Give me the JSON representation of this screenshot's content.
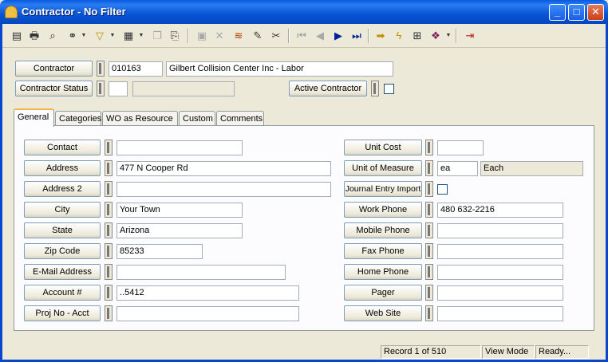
{
  "window": {
    "title": "Contractor - No Filter",
    "buttons": {
      "minimize": "_",
      "maximize": "□",
      "close": "✕"
    }
  },
  "header": {
    "contractor_label": "Contractor",
    "contractor_id": "010163",
    "contractor_name": "Gilbert Collision Center Inc - Labor",
    "status_label": "Contractor Status",
    "status_code": "",
    "status_desc": "",
    "active_label": "Active Contractor"
  },
  "tabs": [
    "General",
    "Categories",
    "WO as Resource",
    "Custom",
    "Comments"
  ],
  "left_fields": [
    {
      "label": "Contact",
      "value": ""
    },
    {
      "label": "Address",
      "value": "477 N Cooper Rd"
    },
    {
      "label": "Address 2",
      "value": ""
    },
    {
      "label": "City",
      "value": "Your Town"
    },
    {
      "label": "State",
      "value": "Arizona"
    },
    {
      "label": "Zip Code",
      "value": "85233"
    },
    {
      "label": "E-Mail Address",
      "value": ""
    },
    {
      "label": "Account #",
      "value": "..5412"
    },
    {
      "label": "Proj No - Acct",
      "value": ""
    }
  ],
  "right_fields": [
    {
      "label": "Unit Cost",
      "value": ""
    },
    {
      "label": "Unit of Measure",
      "value": "ea",
      "desc": "Each"
    },
    {
      "label": "Journal Entry Import",
      "value": ""
    },
    {
      "label": "Work Phone",
      "value": "480 632-2216"
    },
    {
      "label": "Mobile Phone",
      "value": ""
    },
    {
      "label": "Fax Phone",
      "value": ""
    },
    {
      "label": "Home Phone",
      "value": ""
    },
    {
      "label": "Pager",
      "value": ""
    },
    {
      "label": "Web Site",
      "value": ""
    }
  ],
  "toolbar": {
    "icons": [
      "grid-icon",
      "print-icon",
      "preview-icon",
      "binoculars-icon",
      "filter-icon",
      "form-icon",
      "copy-icon",
      "paste-icon",
      "save-icon",
      "delete-icon",
      "stack-icon",
      "pencil-icon",
      "scissors-icon",
      "first-icon",
      "prev-icon",
      "next-icon",
      "last-icon",
      "arrow-right-icon",
      "lightning-icon",
      "window-icon",
      "book-icon",
      "exit-icon"
    ],
    "glyphs": {
      "grid": "▤",
      "print": "🖶",
      "preview": "⌕",
      "binoculars": "⚭",
      "filter": "▽",
      "form": "▦",
      "copy": "❐",
      "paste": "⎘",
      "save": "▣",
      "delete": "✕",
      "stack": "≋",
      "pencil": "✎",
      "scissors": "✂",
      "first": "⏮",
      "prev": "◀",
      "next": "▶",
      "last": "⏭",
      "arrow": "➡",
      "lightning": "ϟ",
      "window": "⊞",
      "book": "❖",
      "exit": "⇥"
    },
    "dropdown": "▼"
  },
  "status": {
    "record": "Record 1 of 510",
    "mode": "View Mode",
    "state": "Ready..."
  }
}
